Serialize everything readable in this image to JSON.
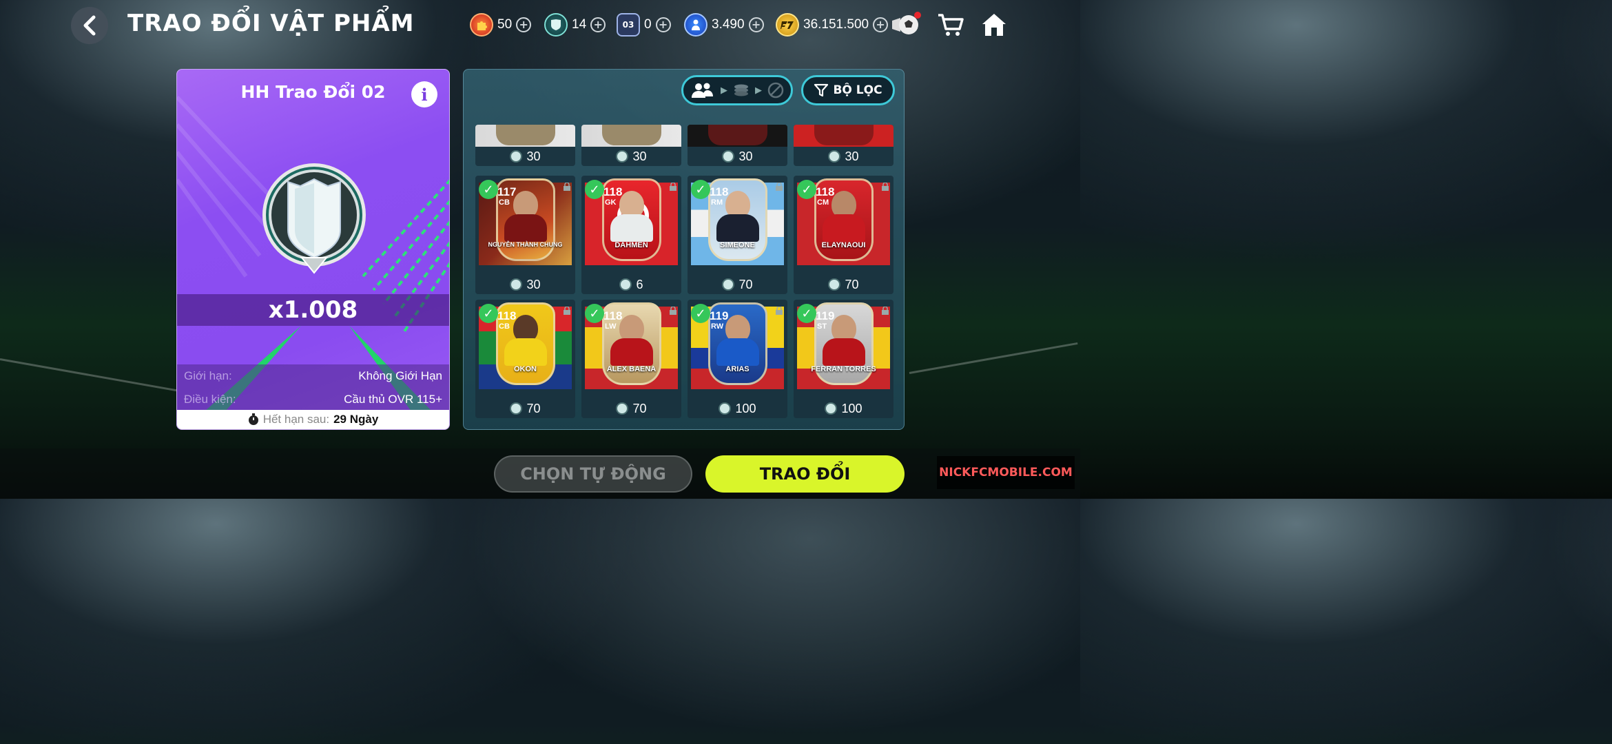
{
  "header": {
    "title": "TRAO ĐỔI VẬT PHẨM",
    "currencies": [
      {
        "icon": "puzzle-token-icon",
        "value": "50"
      },
      {
        "icon": "shield-token-icon",
        "value": "14"
      },
      {
        "icon": "card-token-icon",
        "value": "0",
        "icon_label": "03"
      },
      {
        "icon": "player-token-icon",
        "value": "3.490"
      },
      {
        "icon": "fc-points-icon",
        "value": "36.151.500"
      }
    ],
    "plus_symbol": "+"
  },
  "offer": {
    "title": "HH Trao Đổi 02",
    "info_glyph": "i",
    "quantity": "x1.008",
    "limit_label": "Giới hạn:",
    "limit_value": "Không Giới Hạn",
    "condition_label": "Điều kiện:",
    "condition_value": "Cầu thủ OVR 115+",
    "expire_label": "Hết hạn sau:",
    "expire_value": "29 Ngày"
  },
  "filters": {
    "filter_label": "BỘ LỌC"
  },
  "players_row0": [
    {
      "cost": "30"
    },
    {
      "cost": "30"
    },
    {
      "cost": "30"
    },
    {
      "cost": "30"
    }
  ],
  "players": [
    {
      "ovr": "117",
      "pos": "CB",
      "name": "NGUYỄN THÀNH CHUNG",
      "cost": "30"
    },
    {
      "ovr": "118",
      "pos": "GK",
      "name": "DAHMEN",
      "cost": "6"
    },
    {
      "ovr": "118",
      "pos": "RM",
      "name": "SIMEONE",
      "cost": "70"
    },
    {
      "ovr": "118",
      "pos": "CM",
      "name": "ELAYNAOUI",
      "cost": "70"
    },
    {
      "ovr": "118",
      "pos": "CB",
      "name": "OKON",
      "cost": "70"
    },
    {
      "ovr": "118",
      "pos": "LW",
      "name": "ALEX BAENA",
      "cost": "70"
    },
    {
      "ovr": "119",
      "pos": "RW",
      "name": "ARIAS",
      "cost": "100"
    },
    {
      "ovr": "119",
      "pos": "ST",
      "name": "FERRAN TORRES",
      "cost": "100"
    }
  ],
  "check_glyph": "✓",
  "actions": {
    "auto_label": "CHỌN TỰ ĐỘNG",
    "trade_label": "TRAO ĐỔI"
  },
  "watermark": "NICKFCMOBILE.COM",
  "colors": {
    "accent": "#d9f52a",
    "card_purple": "#8c4ef2",
    "panel_border": "#3ec9d8",
    "check_green": "#35c75a"
  }
}
